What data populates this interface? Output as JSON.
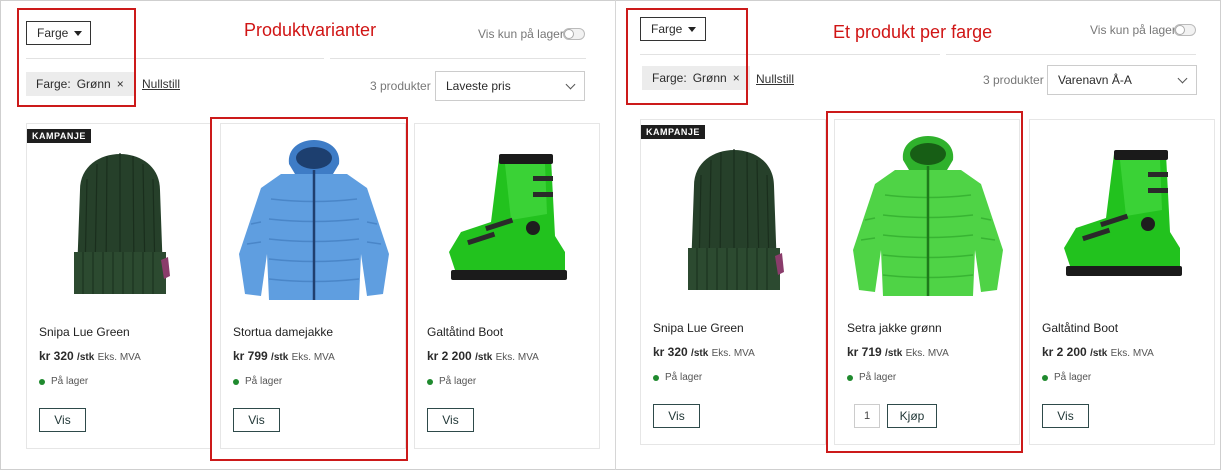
{
  "left": {
    "filter_button": "Farge",
    "annotation": "Produktvarianter",
    "toggle_label": "Vis kun på lager",
    "chip_label": "Farge:",
    "chip_value": "Grønn",
    "chip_remove": "×",
    "reset": "Nullstill",
    "count": "3 produkter",
    "sort": "Laveste pris",
    "products": [
      {
        "badge": "KAMPANJE",
        "name": "Snipa Lue Green",
        "price": "kr 320",
        "unit": "/stk",
        "vat": "Eks. MVA",
        "stock": "På lager",
        "button": "Vis",
        "image": "green-beanie"
      },
      {
        "name": "Stortua damejakke",
        "price": "kr 799",
        "unit": "/stk",
        "vat": "Eks. MVA",
        "stock": "På lager",
        "button": "Vis",
        "image": "blue-jacket"
      },
      {
        "name": "Galtåtind Boot",
        "price": "kr 2 200",
        "unit": "/stk",
        "vat": "Eks. MVA",
        "stock": "På lager",
        "button": "Vis",
        "image": "green-ski-boot"
      }
    ]
  },
  "right": {
    "filter_button": "Farge",
    "annotation": "Et produkt per farge",
    "toggle_label": "Vis kun på lager",
    "chip_label": "Farge:",
    "chip_value": "Grønn",
    "chip_remove": "×",
    "reset": "Nullstill",
    "count": "3 produkter",
    "sort": "Varenavn Å-A",
    "products": [
      {
        "badge": "KAMPANJE",
        "name": "Snipa Lue Green",
        "price": "kr 320",
        "unit": "/stk",
        "vat": "Eks. MVA",
        "stock": "På lager",
        "button": "Vis",
        "image": "green-beanie"
      },
      {
        "name": "Setra jakke grønn",
        "price": "kr 719",
        "unit": "/stk",
        "vat": "Eks. MVA",
        "stock": "På lager",
        "qty": "1",
        "button": "Kjøp",
        "image": "green-jacket"
      },
      {
        "name": "Galtåtind Boot",
        "price": "kr 2 200",
        "unit": "/stk",
        "vat": "Eks. MVA",
        "stock": "På lager",
        "button": "Vis",
        "image": "green-ski-boot"
      }
    ]
  },
  "colors": {
    "annotation": "#d01515",
    "in_stock": "#1f8a2e",
    "beanie": "#243d27",
    "blue_jacket": "#5f9ee0",
    "green_jacket": "#3fcc3a",
    "boot": "#22c21e"
  }
}
